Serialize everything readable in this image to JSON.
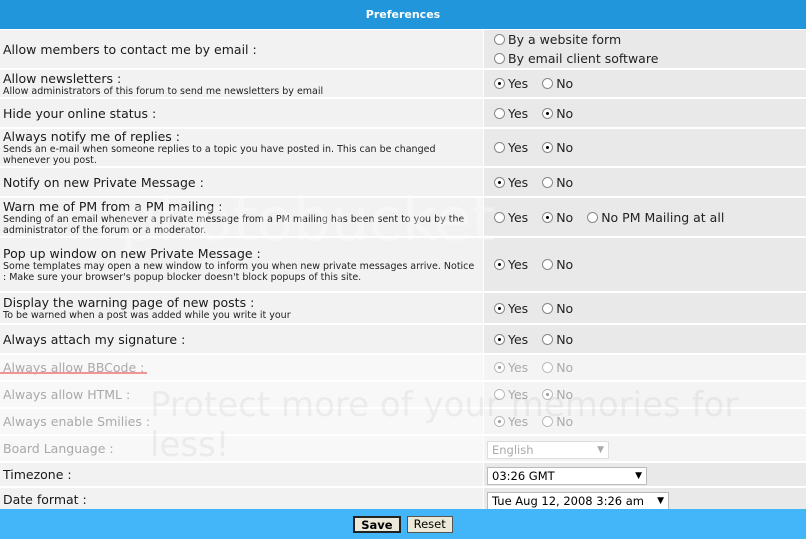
{
  "header": {
    "title": "Preferences"
  },
  "rows": [
    {
      "label": "Allow members to contact me by email :",
      "options": [
        {
          "label": "By a website form",
          "checked": false
        },
        {
          "label": "By email client software",
          "checked": false
        }
      ]
    },
    {
      "label": "Allow newsletters :",
      "desc": "Allow administrators of this forum to send me newsletters by email",
      "options": [
        {
          "label": "Yes",
          "checked": true
        },
        {
          "label": "No",
          "checked": false
        }
      ]
    },
    {
      "label": "Hide your online status :",
      "options": [
        {
          "label": "Yes",
          "checked": false
        },
        {
          "label": "No",
          "checked": true
        }
      ]
    },
    {
      "label": "Always notify me of replies :",
      "desc": "Sends an e-mail when someone replies to a topic you have posted in. This can be changed whenever you post.",
      "options": [
        {
          "label": "Yes",
          "checked": false
        },
        {
          "label": "No",
          "checked": true
        }
      ]
    },
    {
      "label": "Notify on new Private Message :",
      "options": [
        {
          "label": "Yes",
          "checked": true
        },
        {
          "label": "No",
          "checked": false
        }
      ]
    },
    {
      "label": "Warn me of PM from a PM mailing :",
      "desc": "Sending of an email whenever a private message from a PM mailing has been sent to you by the administrator of the forum or a moderator.",
      "options": [
        {
          "label": "Yes",
          "checked": false
        },
        {
          "label": "No",
          "checked": true
        },
        {
          "label": "No PM Mailing at all",
          "checked": false
        }
      ]
    },
    {
      "label": "Pop up window on new Private Message :",
      "desc": "Some templates may open a new window to inform you when new private messages arrive. Notice : Make sure your browser's popup blocker doesn't block popups of this site.",
      "options": [
        {
          "label": "Yes",
          "checked": true
        },
        {
          "label": "No",
          "checked": false
        }
      ]
    },
    {
      "label": "Display the warning page of new posts  :",
      "desc": "To be warned when a post was added while you write it your",
      "options": [
        {
          "label": "Yes",
          "checked": true
        },
        {
          "label": "No",
          "checked": false
        }
      ]
    },
    {
      "label": "Always attach my signature :",
      "options": [
        {
          "label": "Yes",
          "checked": true
        },
        {
          "label": "No",
          "checked": false
        }
      ]
    },
    {
      "label": "Always allow BBCode :",
      "disabled": true,
      "options": [
        {
          "label": "Yes",
          "checked": true
        },
        {
          "label": "No",
          "checked": false
        }
      ]
    },
    {
      "label": "Always allow HTML :",
      "disabled": true,
      "options": [
        {
          "label": "Yes",
          "checked": false
        },
        {
          "label": "No",
          "checked": true
        }
      ]
    },
    {
      "label": "Always enable Smilies :",
      "disabled": true,
      "options": [
        {
          "label": "Yes",
          "checked": true
        },
        {
          "label": "No",
          "checked": false
        }
      ]
    }
  ],
  "selects": {
    "language": {
      "label": "Board Language :",
      "value": "English"
    },
    "timezone": {
      "label": "Timezone :",
      "value": "03:26 GMT"
    },
    "dateformat": {
      "label": "Date format :",
      "value": "Tue Aug 12, 2008 3:26 am"
    }
  },
  "footer": {
    "save": "Save",
    "reset": "Reset"
  },
  "watermark": {
    "line1": "photobucket",
    "line2": "Protect more of your memories for less!"
  }
}
